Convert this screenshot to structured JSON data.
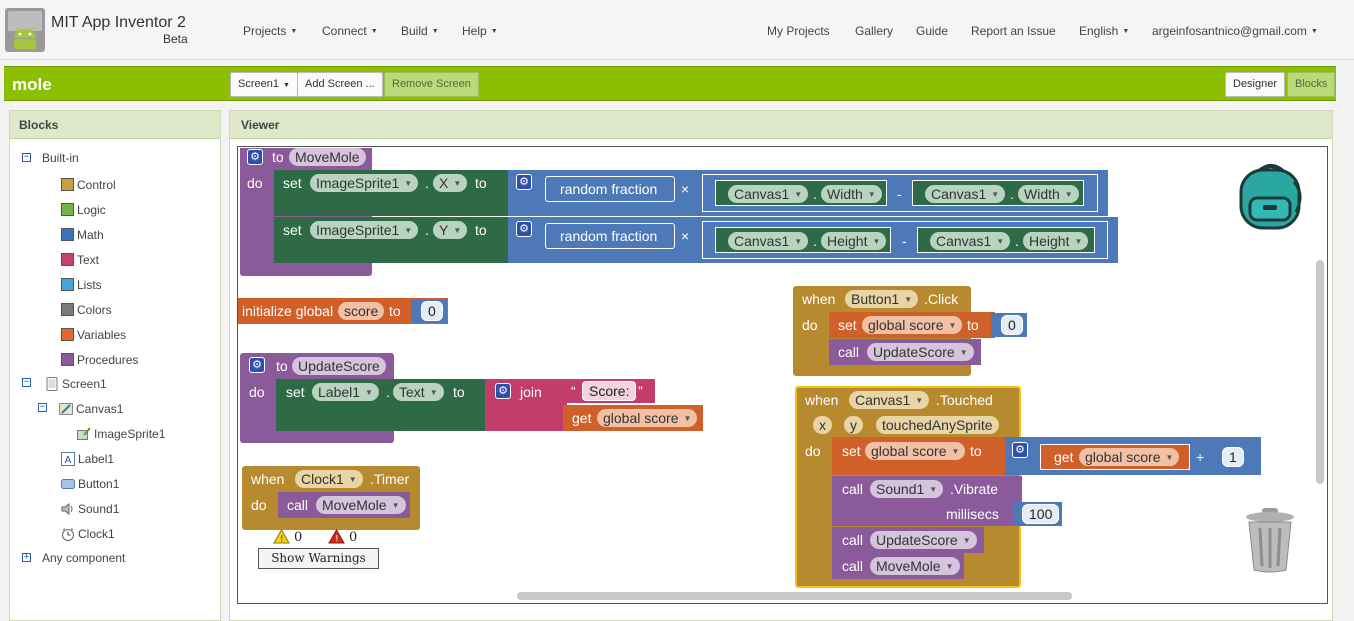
{
  "header": {
    "app_title": "MIT App Inventor 2",
    "app_subtitle": "Beta",
    "menus": [
      "Projects",
      "Connect",
      "Build",
      "Help"
    ],
    "right_links": [
      "My Projects",
      "Gallery",
      "Guide",
      "Report an Issue"
    ],
    "language": "English",
    "account": "argeinfosantnico@gmail.com"
  },
  "toolbar": {
    "project_name": "mole",
    "screen_select": "Screen1",
    "add_screen": "Add Screen ...",
    "remove_screen": "Remove Screen",
    "designer": "Designer",
    "blocks": "Blocks"
  },
  "blocks_panel": {
    "title": "Blocks",
    "builtin_label": "Built-in",
    "builtin": [
      {
        "label": "Control",
        "color": "#c8a03c"
      },
      {
        "label": "Logic",
        "color": "#72b34a"
      },
      {
        "label": "Math",
        "color": "#3f6fc0"
      },
      {
        "label": "Text",
        "color": "#c4436e"
      },
      {
        "label": "Lists",
        "color": "#42a6dd"
      },
      {
        "label": "Colors",
        "color": "#7a7a7a"
      },
      {
        "label": "Variables",
        "color": "#e0672f"
      },
      {
        "label": "Procedures",
        "color": "#8a5a9a"
      }
    ],
    "screen": "Screen1",
    "canvas": "Canvas1",
    "image_sprite": "ImageSprite1",
    "components": [
      "Label1",
      "Button1",
      "Sound1",
      "Clock1"
    ],
    "any_component": "Any component"
  },
  "viewer": {
    "title": "Viewer",
    "warnings_count": "0",
    "errors_count": "0",
    "show_warnings": "Show Warnings"
  },
  "blocks": {
    "kw_to": "to",
    "kw_do": "do",
    "kw_set": "set",
    "kw_when": "when",
    "kw_call": "call",
    "kw_get": "get",
    "kw_join": "join",
    "dot": ".",
    "times": "×",
    "minus": "-",
    "plus": "+",
    "move_mole": "MoveMole",
    "update_score": "UpdateScore",
    "image_sprite": "ImageSprite1",
    "prop_x": "X",
    "prop_y": "Y",
    "random_fraction": "random fraction",
    "canvas": "Canvas1",
    "width": "Width",
    "height": "Height",
    "init_global": "initialize global",
    "var_score": "score",
    "global_score": "global score",
    "zero": "0",
    "one": "1",
    "hundred": "100",
    "label1": "Label1",
    "text_prop": "Text",
    "score_str": "Score: ",
    "open_quote": "“",
    "close_quote": "”",
    "clock1": "Clock1",
    "timer": ".Timer",
    "button1": "Button1",
    "click": ".Click",
    "touched": ".Touched",
    "param_x": "x",
    "param_y": "y",
    "param_touched": "touchedAnySprite",
    "sound1": "Sound1",
    "vibrate": ".Vibrate",
    "millisecs": "millisecs"
  },
  "colors": {
    "topbar": "#f5f5f5",
    "green_bar": "#8cbf00",
    "procedure": "#8a5a9a",
    "setter": "#2d6a45",
    "math": "#4d79b8",
    "variable": "#d0602a",
    "event": "#b88a30",
    "text": "#c43c6c"
  }
}
